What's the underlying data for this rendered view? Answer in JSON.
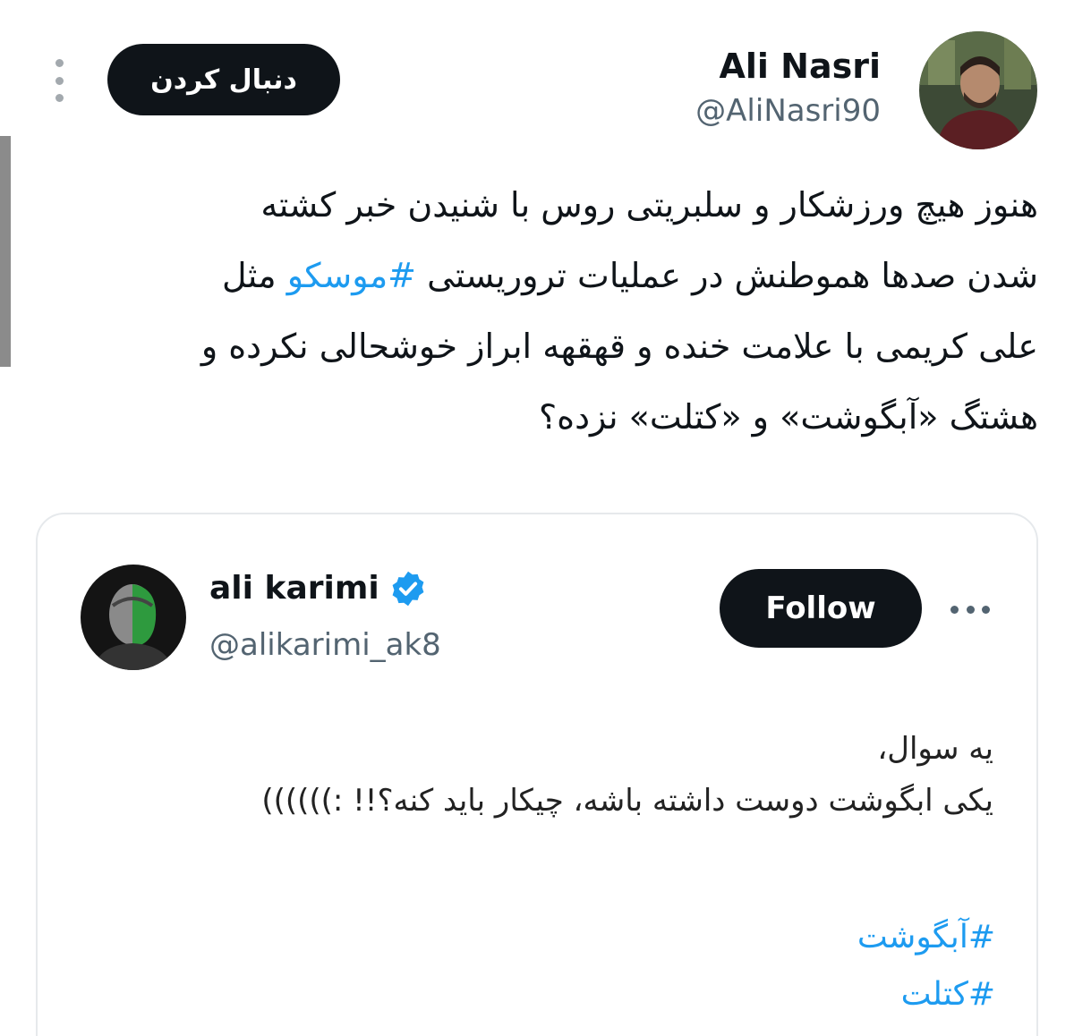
{
  "tweet": {
    "author_name": "Ali Nasri",
    "author_handle": "@AliNasri90",
    "follow_label": "دنبال کردن",
    "text_lines": [
      "هنوز هیچ ورزشکار و سلبریتی روس با شنیدن خبر کشته",
      "مثل",
      "#موسکو",
      "شدن صدها هموطنش در عملیات تروریستی",
      "علی کریمی با علامت خنده و قهقهه ابراز خوشحالی نکرده و",
      "هشتگ «آبگوشت» و «کتلت» نزده؟"
    ]
  },
  "quoted": {
    "author_name": "ali karimi",
    "author_handle": "@alikarimi_ak8",
    "follow_label": "Follow",
    "text_lines": [
      "یه سوال،",
      "یکی ابگوشت دوست داشته باشه، چیکار باید کنه؟!! :))))))"
    ],
    "hashtags": [
      "#آبگوشت",
      "#کتلت"
    ]
  },
  "icons": {
    "verified": "verified-badge-icon",
    "more_vertical": "more-vertical-icon",
    "more_horizontal": "more-horizontal-icon"
  },
  "colors": {
    "accent": "#1d9bf0",
    "button_bg": "#0f1419",
    "secondary_text": "#536471"
  }
}
